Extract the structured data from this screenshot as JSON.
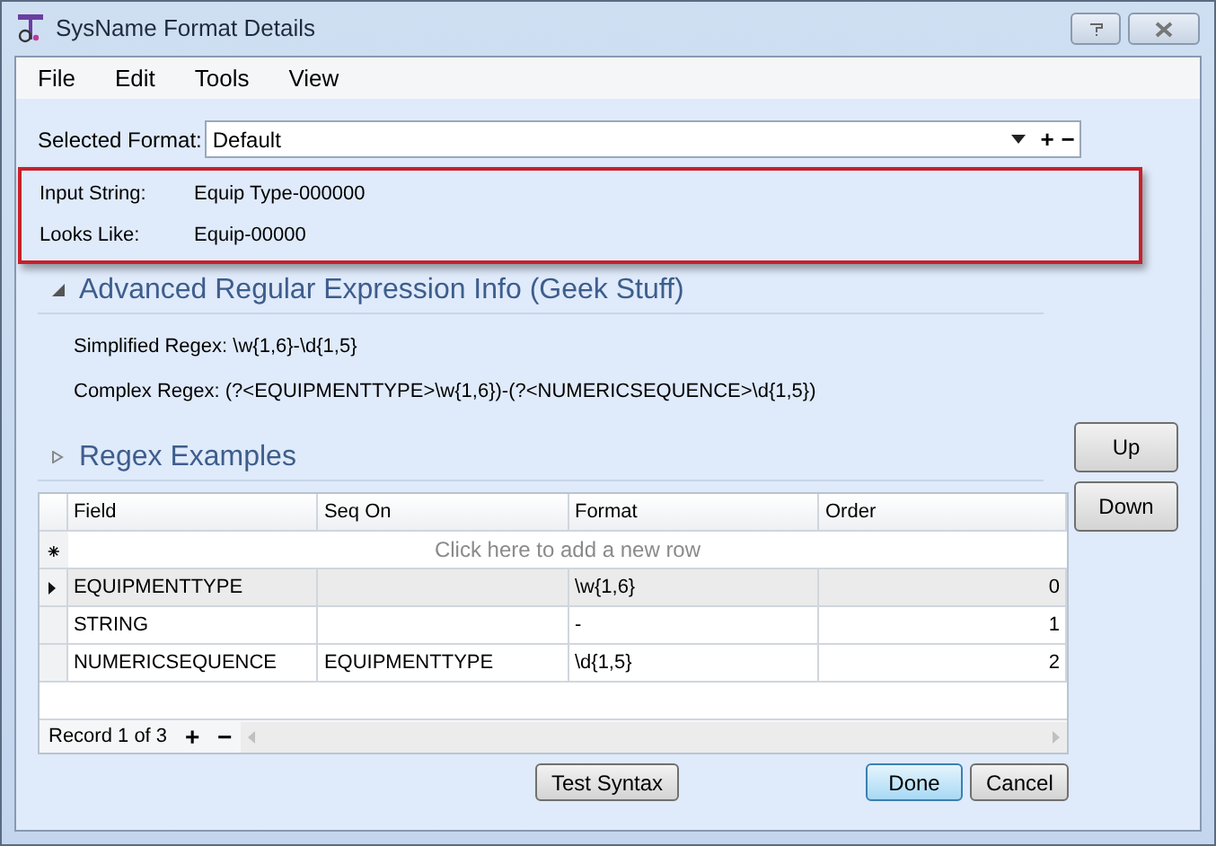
{
  "window": {
    "title": "SysName Format Details"
  },
  "menu": [
    "File",
    "Edit",
    "Tools",
    "View"
  ],
  "selected_format": {
    "label": "Selected Format:",
    "value": "Default",
    "buttons": [
      "+",
      "−"
    ]
  },
  "highlight_box": {
    "rows": [
      {
        "label": "Input String:",
        "value": "Equip Type-000000"
      },
      {
        "label": "Looks Like:",
        "value": "Equip-00000"
      }
    ]
  },
  "sections": [
    {
      "title": "Advanced Regular Expression Info (Geek Stuff)",
      "expanded": true,
      "lines": [
        "Simplified Regex: \\w{1,6}-\\d{1,5}",
        "Complex Regex: (?<EQUIPMENTTYPE>\\w{1,6})-(?<NUMERICSEQUENCE>\\d{1,5})"
      ]
    },
    {
      "title": "Regex Examples",
      "expanded": false
    }
  ],
  "side_buttons": [
    "Up",
    "Down"
  ],
  "grid": {
    "columns": [
      "Field",
      "Seq On",
      "Format",
      "Order"
    ],
    "new_row_marker": "⁕",
    "new_row": "Click here to add a new row",
    "rows": [
      {
        "cells": [
          "EQUIPMENTTYPE",
          "",
          "\\w{1,6}",
          "0"
        ],
        "selected": true
      },
      {
        "cells": [
          "STRING",
          "",
          "-",
          "1"
        ],
        "selected": false
      },
      {
        "cells": [
          "NUMERICSEQUENCE",
          "EQUIPMENTTYPE",
          "\\d{1,5}",
          "2"
        ],
        "selected": false
      }
    ],
    "footer": {
      "record": "Record 1 of 3",
      "buttons": [
        "+",
        "−"
      ]
    }
  },
  "buttons": [
    {
      "label": "Test Syntax",
      "default": false
    },
    {
      "label": "Done",
      "default": true
    },
    {
      "label": "Cancel",
      "default": false
    }
  ]
}
